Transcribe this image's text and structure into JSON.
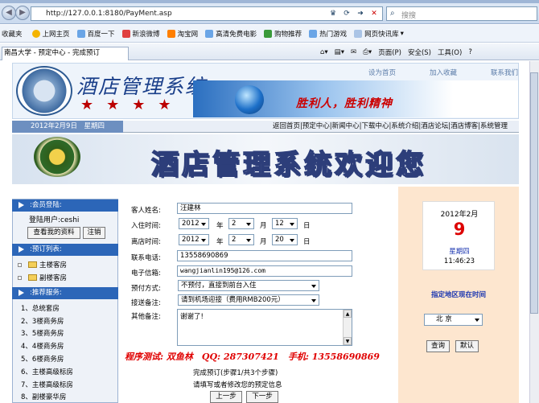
{
  "browser": {
    "url": "http://127.0.0.1:8180/PayMent.asp",
    "search_placeholder": "搜搜",
    "tab_title": "南昌大学 - 预定中心 - 完成预订",
    "favorites_label": "收藏夹",
    "favorites": [
      "上网主页",
      "百度一下",
      "新浪微博",
      "淘宝网",
      "高清免费电影",
      "购物推荐",
      "热门游戏",
      "网页快讯库"
    ],
    "commands": [
      "页面(P)",
      "安全(S)",
      "工具(O)"
    ]
  },
  "header": {
    "logo_title": "酒店管理系统",
    "stars": "★★★★",
    "slogan": "胜利人，胜利精神",
    "top_links": [
      "设为首页",
      "加入收藏",
      "联系我们"
    ],
    "date": "2012年2月9日　星期四",
    "menu": "返回首页|预定中心|新闻中心|下载中心|系统介绍|酒店论坛|酒店博客|系统管理",
    "welcome": "酒店管理系统欢迎您"
  },
  "sidebar": {
    "login_head": ":会员登陆:",
    "login_user": "登陆用户:ceshi",
    "my_data_button": "查看我的资料",
    "logout_button": "注销",
    "rooms_head": ":预订列表:",
    "rooms": [
      "主楼客房",
      "副楼客房"
    ],
    "services_head": ":推荐服务:",
    "services": [
      "1、总统套房",
      "2、3楼商务房",
      "3、5楼商务房",
      "4、4楼商务房",
      "5、6楼商务房",
      "6、主楼高级标房",
      "7、主楼高级标房",
      "8、副楼豪华房"
    ]
  },
  "form": {
    "name_label": "客人姓名:",
    "name_value": "汪建林",
    "checkin_label": "入住时间:",
    "checkin": {
      "year": "2012",
      "month": "2",
      "day": "12"
    },
    "checkout_label": "离店时间:",
    "checkout": {
      "year": "2012",
      "month": "2",
      "day": "20"
    },
    "unit_year": "年",
    "unit_month": "月",
    "unit_day": "日",
    "phone_label": "联系电话:",
    "phone_value": "13558690869",
    "email_label": "电子信箱:",
    "email_value": "wangjianlin195@126.com",
    "pay_label": "预付方式:",
    "pay_value": "不预付，直接到前台入住",
    "pickup_label": "接送备注:",
    "pickup_value": "请到机场迎接（费用RMB200元）",
    "notes_label": "其他备注:",
    "notes_value": "谢谢了!",
    "test_line": "程序测试: 双鱼林　QQ: 287307421　手机: 13558690869",
    "step_text": "完成预订(步骤1/共3个步骤)",
    "tip_text": "请填写或者修改您的预定信息",
    "prev_button": "上一步",
    "next_button": "下一步"
  },
  "right": {
    "cal_year_month": "2012年2月",
    "cal_day": "9",
    "cal_week": "星期四",
    "cal_time": "11:46:23",
    "zone_title": "指定地区现在时间",
    "city": "北 京",
    "query_button": "查询",
    "default_button": "默认"
  }
}
